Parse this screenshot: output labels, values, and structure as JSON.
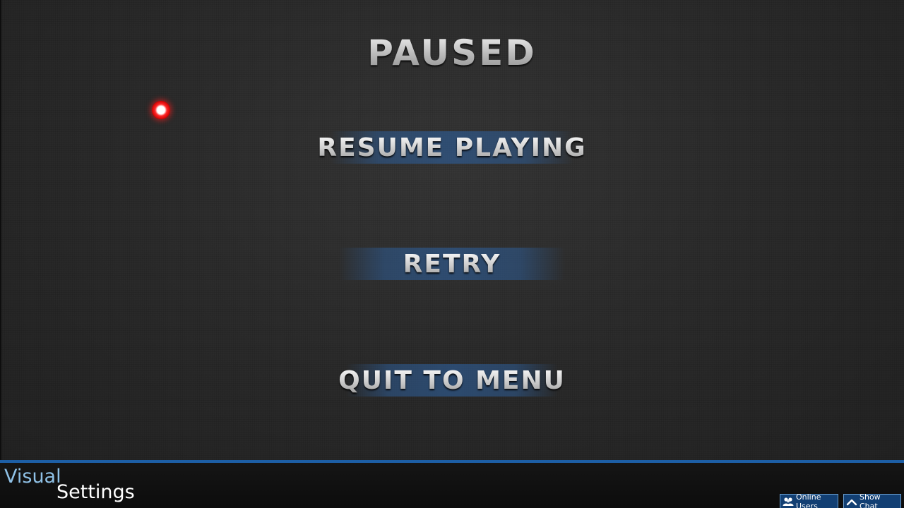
{
  "pause_menu": {
    "title": "PAUSED",
    "options": [
      {
        "label": "RESUME PLAYING"
      },
      {
        "label": "RETRY"
      },
      {
        "label": "QUIT TO MENU"
      }
    ]
  },
  "bottom_bar": {
    "settings_label_line1": "Visual",
    "settings_label_line2": "Settings",
    "online_users_label": "Online Users",
    "show_chat_label": "Show Chat",
    "online_users_icon": "users-icon",
    "show_chat_icon": "chevron-up-icon"
  },
  "colors": {
    "accent_bar": "#1d5fa6",
    "menu_highlight": "#2e5c94",
    "cursor": "#ff2a2a",
    "visual_text": "#8fc1e6"
  }
}
